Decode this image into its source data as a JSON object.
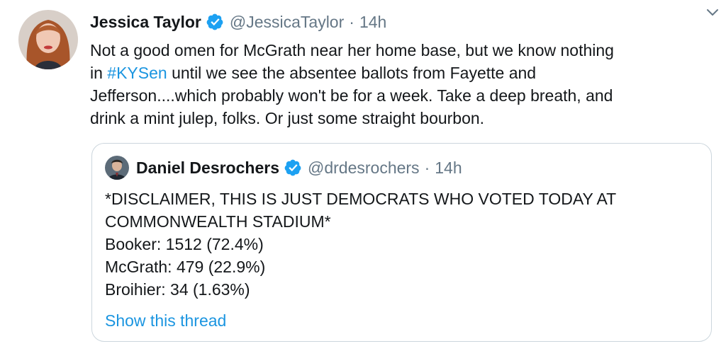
{
  "tweet": {
    "author_name": "Jessica Taylor",
    "handle": "@JessicaTaylor",
    "separator": "·",
    "time": "14h",
    "text": {
      "line1": "Not a good omen for McGrath near her home base, but we know nothing",
      "line2_prefix": "in ",
      "hashtag": "#KYSen",
      "line2_suffix": " until we see the absentee ballots from Fayette and",
      "line3": "Jefferson....which probably won't be for a week. Take a deep breath, and",
      "line4": "drink a mint julep, folks. Or just some straight bourbon."
    },
    "icons": {
      "verified": "verified-badge-icon",
      "menu": "chevron-down-icon"
    }
  },
  "quote": {
    "author_name": "Daniel Desrochers",
    "handle": "@drdesrochers",
    "separator": "·",
    "time": "14h",
    "lines": {
      "l1": "*DISCLAIMER, THIS IS JUST DEMOCRATS WHO VOTED TODAY AT",
      "l2": "COMMONWEALTH STADIUM*",
      "l3": "Booker: 1512 (72.4%)",
      "l4": "McGrath: 479 (22.9%)",
      "l5": "Broihier: 34 (1.63%)"
    },
    "show_thread": "Show this thread"
  },
  "colors": {
    "accent": "#1b95e0",
    "secondary_text": "#657786",
    "primary_text": "#14171a",
    "border": "#ccd6dd"
  }
}
